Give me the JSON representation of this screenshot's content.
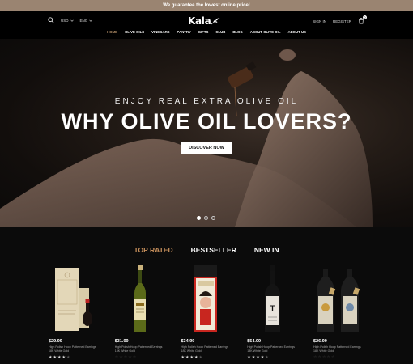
{
  "banner": {
    "text": "We guarantee the lowest online price!"
  },
  "header": {
    "currency": "USD",
    "language": "ENG",
    "logo": "Kala",
    "sign_in": "SIGN IN",
    "register": "REGISTER",
    "cart_count": "0"
  },
  "nav": {
    "items": [
      "HOME",
      "OLIVE OILS",
      "VINEGARS",
      "PANTRY",
      "GIFTS",
      "CLUB",
      "BLOG",
      "ABOUT OLIVE OIL",
      "ABOUT US"
    ],
    "active": "HOME"
  },
  "hero": {
    "subtitle": "ENJOY REAL EXTRA OLIVE OIL",
    "title": "WHY OLIVE OIL LOVERS?",
    "button": "DISCOVER NOW",
    "slides": 3,
    "active_slide": 1
  },
  "tabs": {
    "items": [
      "TOP RATED",
      "BESTSELLER",
      "NEW IN"
    ],
    "active": "TOP RATED"
  },
  "products": [
    {
      "price": "$29.99",
      "desc": "High Polish Hoop Patterned Earrings 18K White Gold",
      "rating": 4
    },
    {
      "price": "$31.99",
      "desc": "High Polish Hoop Patterned Earrings 18K White Gold",
      "rating": 0
    },
    {
      "price": "$34.99",
      "desc": "High Polish Hoop Patterned Earrings 18K White Gold",
      "rating": 4
    },
    {
      "price": "$54.99",
      "desc": "High Polish Hoop Patterned Earrings 18K White Gold",
      "rating": 4
    },
    {
      "price": "$26.99",
      "desc": "High Polish Hoop Patterned Earrings 18K White Gold",
      "rating": 0
    }
  ],
  "colors": {
    "accent": "#c8905c",
    "banner": "#9a8471",
    "background": "#0b0b0b"
  }
}
